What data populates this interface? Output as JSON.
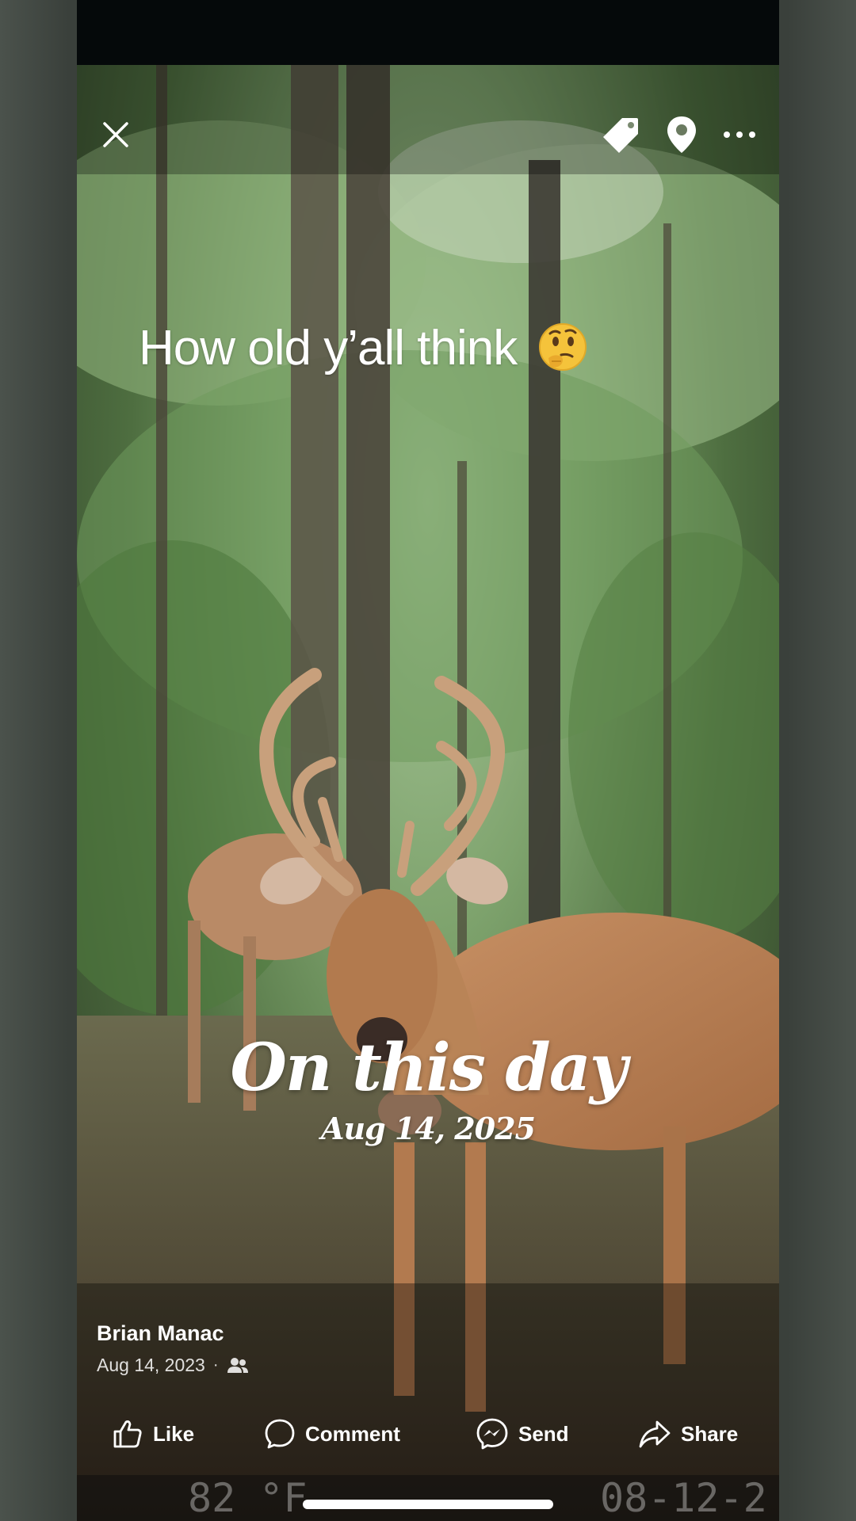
{
  "toolbar": {
    "close_icon": "close-icon",
    "tag_icon": "tag-icon",
    "location_icon": "location-pin-icon",
    "more_icon": "more-options-icon"
  },
  "post": {
    "caption": "How old y’all think",
    "caption_emoji": "🤔",
    "memory_title": "On this day",
    "memory_date": "Aug 14, 2025",
    "author": "Brian Manac",
    "posted_date": "Aug 14, 2023",
    "separator": "·",
    "audience_icon": "friends-icon"
  },
  "trail_camera": {
    "temperature": "82 °F",
    "date": "08-12-2"
  },
  "actions": {
    "like": "Like",
    "comment": "Comment",
    "send": "Send",
    "share": "Share"
  },
  "colors": {
    "text": "#ffffff",
    "top_bar": "#05090a"
  }
}
